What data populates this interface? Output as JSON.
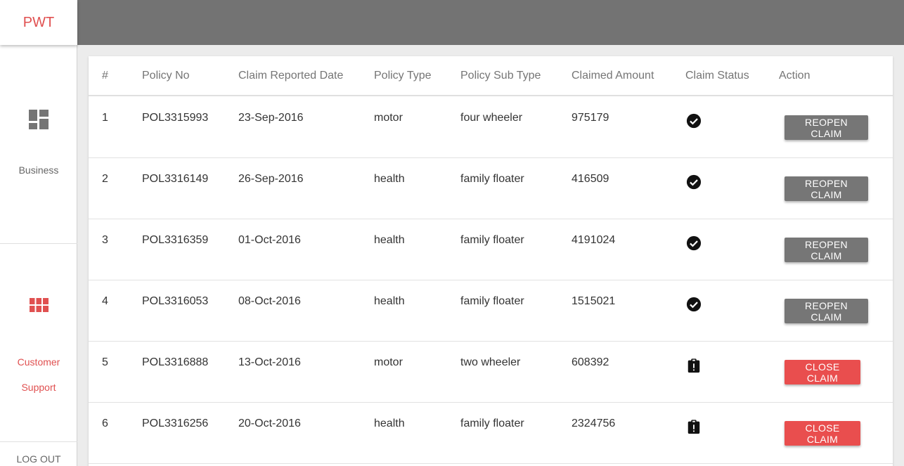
{
  "brand": "PWT",
  "sidebar": {
    "items": [
      {
        "label": "Business",
        "icon": "dashboard-icon"
      },
      {
        "label": "Customer Support",
        "icon": "grid-icon"
      }
    ],
    "logout": "LOG OUT"
  },
  "colors": {
    "accent": "#e05050",
    "topbar": "#737373",
    "reopen": "#767676",
    "close": "#e94e4e"
  },
  "table": {
    "headers": [
      "#",
      "Policy No",
      "Claim Reported Date",
      "Policy Type",
      "Policy Sub Type",
      "Claimed Amount",
      "Claim Status",
      "Action"
    ],
    "rows": [
      {
        "num": "1",
        "policy": "POL3315993",
        "date": "23-Sep-2016",
        "type": "motor",
        "subtype": "four wheeler",
        "amount": "975179",
        "status": "closed",
        "action": "REOPEN CLAIM"
      },
      {
        "num": "2",
        "policy": "POL3316149",
        "date": "26-Sep-2016",
        "type": "health",
        "subtype": "family floater",
        "amount": "416509",
        "status": "closed",
        "action": "REOPEN CLAIM"
      },
      {
        "num": "3",
        "policy": "POL3316359",
        "date": "01-Oct-2016",
        "type": "health",
        "subtype": "family floater",
        "amount": "4191024",
        "status": "closed",
        "action": "REOPEN CLAIM"
      },
      {
        "num": "4",
        "policy": "POL3316053",
        "date": "08-Oct-2016",
        "type": "health",
        "subtype": "family floater",
        "amount": "1515021",
        "status": "closed",
        "action": "REOPEN CLAIM"
      },
      {
        "num": "5",
        "policy": "POL3316888",
        "date": "13-Oct-2016",
        "type": "motor",
        "subtype": "two wheeler",
        "amount": "608392",
        "status": "open",
        "action": "CLOSE CLAIM"
      },
      {
        "num": "6",
        "policy": "POL3316256",
        "date": "20-Oct-2016",
        "type": "health",
        "subtype": "family floater",
        "amount": "2324756",
        "status": "open",
        "action": "CLOSE CLAIM"
      }
    ]
  }
}
